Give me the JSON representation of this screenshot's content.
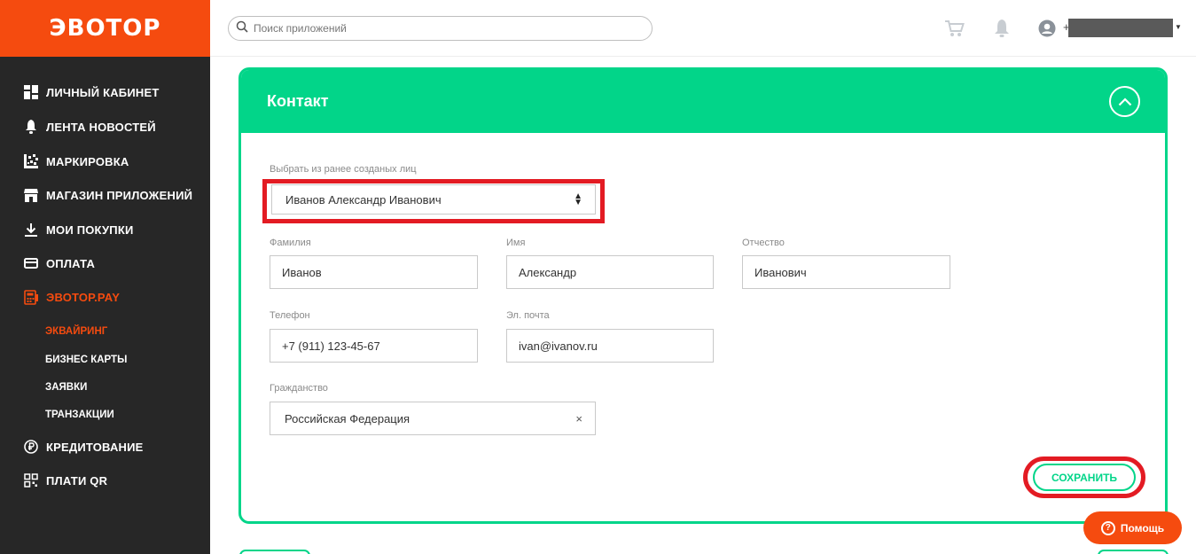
{
  "brand": {
    "logo": "ЭВОТОР",
    "accent": "#f54b0f",
    "green": "#02d589"
  },
  "header": {
    "search_placeholder": "Поиск приложений",
    "icons": [
      "search-icon",
      "cart-icon",
      "bell-icon",
      "user-icon"
    ],
    "user_prefix": "+"
  },
  "sidebar": {
    "items": [
      {
        "label": "ЛИЧНЫЙ КАБИНЕТ",
        "icon": "dashboard-icon"
      },
      {
        "label": "ЛЕНТА НОВОСТЕЙ",
        "icon": "bell-icon"
      },
      {
        "label": "МАРКИРОВКА",
        "icon": "datamatrix-icon"
      },
      {
        "label": "МАГАЗИН ПРИЛОЖЕНИЙ",
        "icon": "store-icon"
      },
      {
        "label": "МОИ ПОКУПКИ",
        "icon": "download-icon"
      },
      {
        "label": "ОПЛАТА",
        "icon": "card-icon"
      },
      {
        "label": "ЭВОТОР.PAY",
        "icon": "terminal-icon",
        "active": true
      },
      {
        "label": "КРЕДИТОВАНИЕ",
        "icon": "ruble-icon"
      },
      {
        "label": "ПЛАТИ QR",
        "icon": "qr-icon"
      }
    ],
    "subitems": [
      {
        "label": "ЭКВАЙРИНГ",
        "active": true
      },
      {
        "label": "БИЗНЕС КАРТЫ"
      },
      {
        "label": "ЗАЯВКИ"
      },
      {
        "label": "ТРАНЗАКЦИИ"
      }
    ]
  },
  "card": {
    "title": "Контакт",
    "select_label": "Выбрать из ранее созданых лиц",
    "select_value": "Иванов Александр Иванович",
    "fields": {
      "lastname": {
        "label": "Фамилия",
        "value": "Иванов"
      },
      "firstname": {
        "label": "Имя",
        "value": "Александр"
      },
      "middlename": {
        "label": "Отчество",
        "value": "Иванович"
      },
      "phone": {
        "label": "Телефон",
        "value": "+7 (911) 123-45-67"
      },
      "email": {
        "label": "Эл. почта",
        "value": "ivan@ivanov.ru"
      },
      "citizenship": {
        "label": "Гражданство",
        "value": "Российская Федерация"
      }
    },
    "clear_symbol": "×",
    "save_label": "СОХРАНИТЬ"
  },
  "help": {
    "label": "Помощь",
    "icon_text": "?"
  }
}
